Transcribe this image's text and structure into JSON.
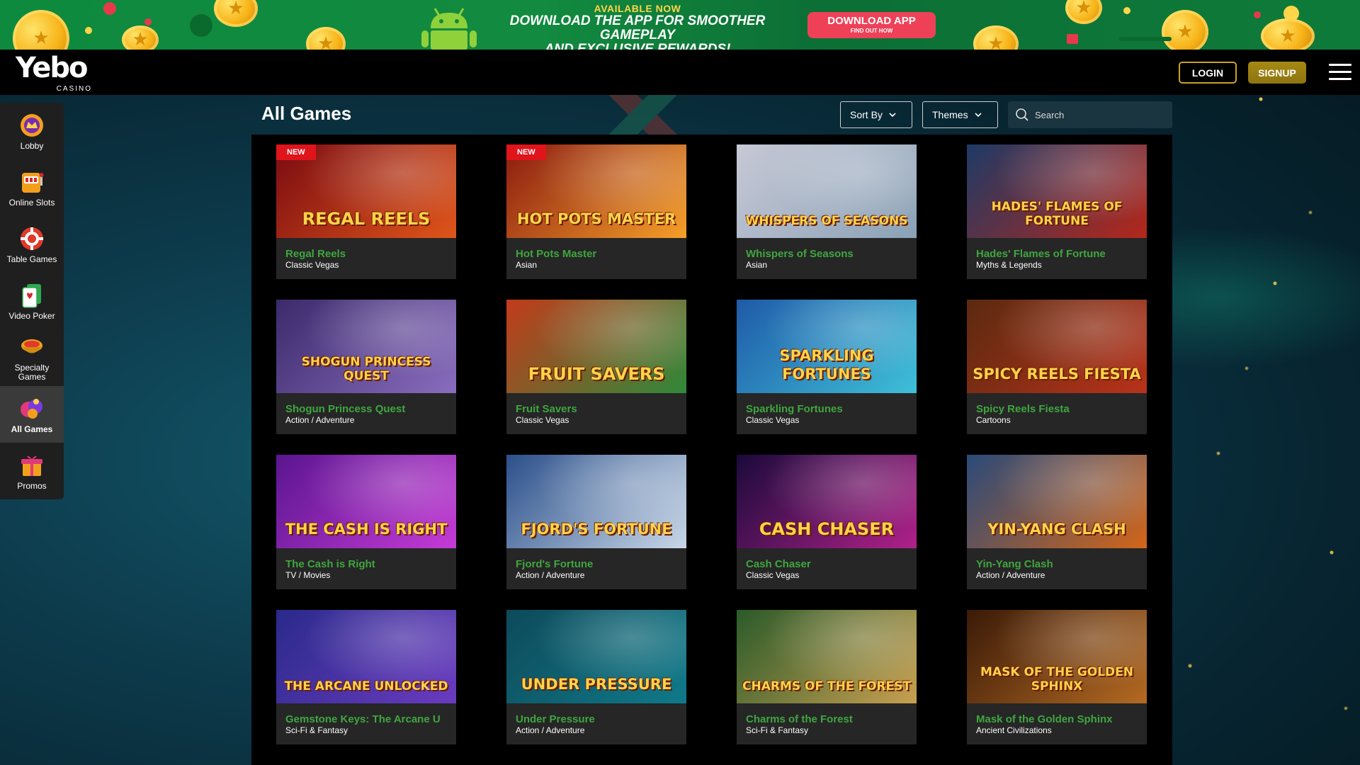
{
  "promo": {
    "kicker": "AVAILABLE NOW",
    "headline_1": "DOWNLOAD THE APP FOR SMOOTHER GAMEPLAY",
    "headline_2": "AND EXCLUSIVE REWARDS!",
    "button_main": "DOWNLOAD APP",
    "button_sub": "FIND OUT HOW",
    "icon": "android-icon",
    "bg_color": "#0e8a3e",
    "button_color": "#ee4158"
  },
  "header": {
    "logo_word": "Yebo",
    "logo_sub": "CASINO",
    "login_label": "LOGIN",
    "signup_label": "SIGNUP",
    "menu_icon": "hamburger-menu-icon",
    "accent_color": "#c9a22a"
  },
  "sidebar": {
    "items": [
      {
        "label": "Lobby",
        "icon": "lobby-icon",
        "active": false
      },
      {
        "label": "Online Slots",
        "icon": "slot-machine-icon",
        "active": false
      },
      {
        "label": "Table Games",
        "icon": "poker-chip-icon",
        "active": false
      },
      {
        "label": "Video Poker",
        "icon": "playing-card-icon",
        "active": false
      },
      {
        "label": "Specialty Games",
        "icon": "specialty-bowl-icon",
        "active": false
      },
      {
        "label": "All Games",
        "icon": "all-games-icon",
        "active": true
      },
      {
        "label": "Promos",
        "icon": "gift-icon",
        "active": false
      }
    ]
  },
  "main": {
    "title": "All Games",
    "sort_label": "Sort By",
    "themes_label": "Themes",
    "search_placeholder": "Search",
    "name_color": "#3fa63f"
  },
  "games": [
    {
      "name": "Regal Reels",
      "genre": "Classic Vegas",
      "art_title": "REGAL REELS",
      "badge": "NEW",
      "bg": [
        "#7a0b12",
        "#e0561a"
      ]
    },
    {
      "name": "Hot Pots Master",
      "genre": "Asian",
      "art_title": "HOT POTS MASTER",
      "badge": "NEW",
      "bg": [
        "#8a1a10",
        "#f5a02a"
      ]
    },
    {
      "name": "Whispers of Seasons",
      "genre": "Asian",
      "art_title": "WHISPERS OF SEASONS",
      "badge": "",
      "bg": [
        "#c7c9d6",
        "#8aa1b6"
      ]
    },
    {
      "name": "Hades' Flames of Fortune",
      "genre": "Myths & Legends",
      "art_title": "HADES' FLAMES OF FORTUNE",
      "badge": "",
      "bg": [
        "#1e3a66",
        "#b5271a"
      ]
    },
    {
      "name": "Shogun Princess Quest",
      "genre": "Action / Adventure",
      "art_title": "SHOGUN PRINCESS QUEST",
      "badge": "",
      "bg": [
        "#3b2a6b",
        "#8a6dbf"
      ]
    },
    {
      "name": "Fruit Savers",
      "genre": "Classic Vegas",
      "art_title": "FRUIT SAVERS",
      "badge": "",
      "bg": [
        "#c23b1b",
        "#2f8a3a"
      ]
    },
    {
      "name": "Sparkling Fortunes",
      "genre": "Classic Vegas",
      "art_title": "SPARKLING FORTUNES",
      "badge": "",
      "bg": [
        "#1f5aa8",
        "#3ec0d8"
      ]
    },
    {
      "name": "Spicy Reels Fiesta",
      "genre": "Cartoons",
      "art_title": "SPICY REELS FIESTA",
      "badge": "",
      "bg": [
        "#5a2a10",
        "#b8321a"
      ]
    },
    {
      "name": "The Cash is Right",
      "genre": "TV / Movies",
      "art_title": "THE CASH IS RIGHT",
      "badge": "",
      "bg": [
        "#5a1590",
        "#c53bd6"
      ]
    },
    {
      "name": "Fjord's Fortune",
      "genre": "Action / Adventure",
      "art_title": "FJORD'S FORTUNE",
      "badge": "",
      "bg": [
        "#2b4f8a",
        "#c9d8e8"
      ]
    },
    {
      "name": "Cash Chaser",
      "genre": "Classic Vegas",
      "art_title": "CASH CHASER",
      "badge": "",
      "bg": [
        "#1a0a3a",
        "#b0218a"
      ]
    },
    {
      "name": "Yin-Yang Clash",
      "genre": "Action / Adventure",
      "art_title": "YIN-YANG CLASH",
      "badge": "",
      "bg": [
        "#2a4a7a",
        "#d2661a"
      ]
    },
    {
      "name": "Gemstone Keys: The Arcane U",
      "genre": "Sci-Fi & Fantasy",
      "art_title": "THE ARCANE UNLOCKED",
      "badge": "",
      "bg": [
        "#2a2a8a",
        "#6a3bc0"
      ]
    },
    {
      "name": "Under Pressure",
      "genre": "Action / Adventure",
      "art_title": "UNDER PRESSURE",
      "badge": "",
      "bg": [
        "#0d4a5a",
        "#0f7a8a"
      ]
    },
    {
      "name": "Charms of the Forest",
      "genre": "Sci-Fi & Fantasy",
      "art_title": "CHARMS OF THE FOREST",
      "badge": "",
      "bg": [
        "#2a5a2a",
        "#c8a050"
      ]
    },
    {
      "name": "Mask of the Golden Sphinx",
      "genre": "Ancient Civilizations",
      "art_title": "MASK OF THE GOLDEN SPHINX",
      "badge": "",
      "bg": [
        "#3a1a08",
        "#b46a22"
      ]
    }
  ]
}
